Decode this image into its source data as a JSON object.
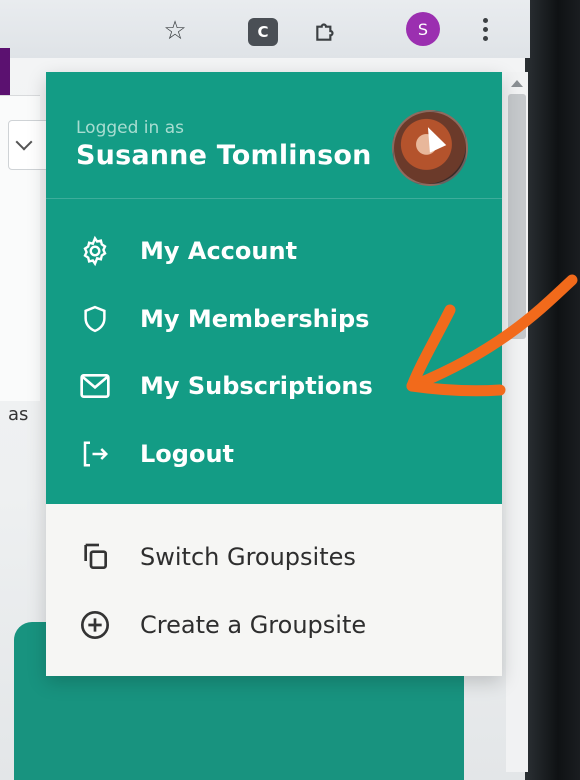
{
  "browser": {
    "profile_initial": "S",
    "icons": [
      "star-icon",
      "extension-icon",
      "puzzle-icon",
      "profile-avatar",
      "more-vert-icon"
    ]
  },
  "background": {
    "fragment_text": "as",
    "colors": {
      "purple": "#5b1170",
      "teal": "#18937f"
    }
  },
  "menu": {
    "logged_in_label": "Logged in as",
    "user_name": "Susanne Tomlinson",
    "items": [
      {
        "label": "My Account",
        "icon": "gear-icon"
      },
      {
        "label": "My Memberships",
        "icon": "shield-icon"
      },
      {
        "label": "My Subscriptions",
        "icon": "envelope-icon"
      },
      {
        "label": "Logout",
        "icon": "logout-icon"
      }
    ],
    "secondary_items": [
      {
        "label": "Switch Groupsites",
        "icon": "switch-icon"
      },
      {
        "label": "Create a Groupsite",
        "icon": "plus-circle-icon"
      }
    ],
    "colors": {
      "header": "#139c85",
      "footer": "#f6f6f4",
      "annotation": "#f26a1b"
    }
  }
}
